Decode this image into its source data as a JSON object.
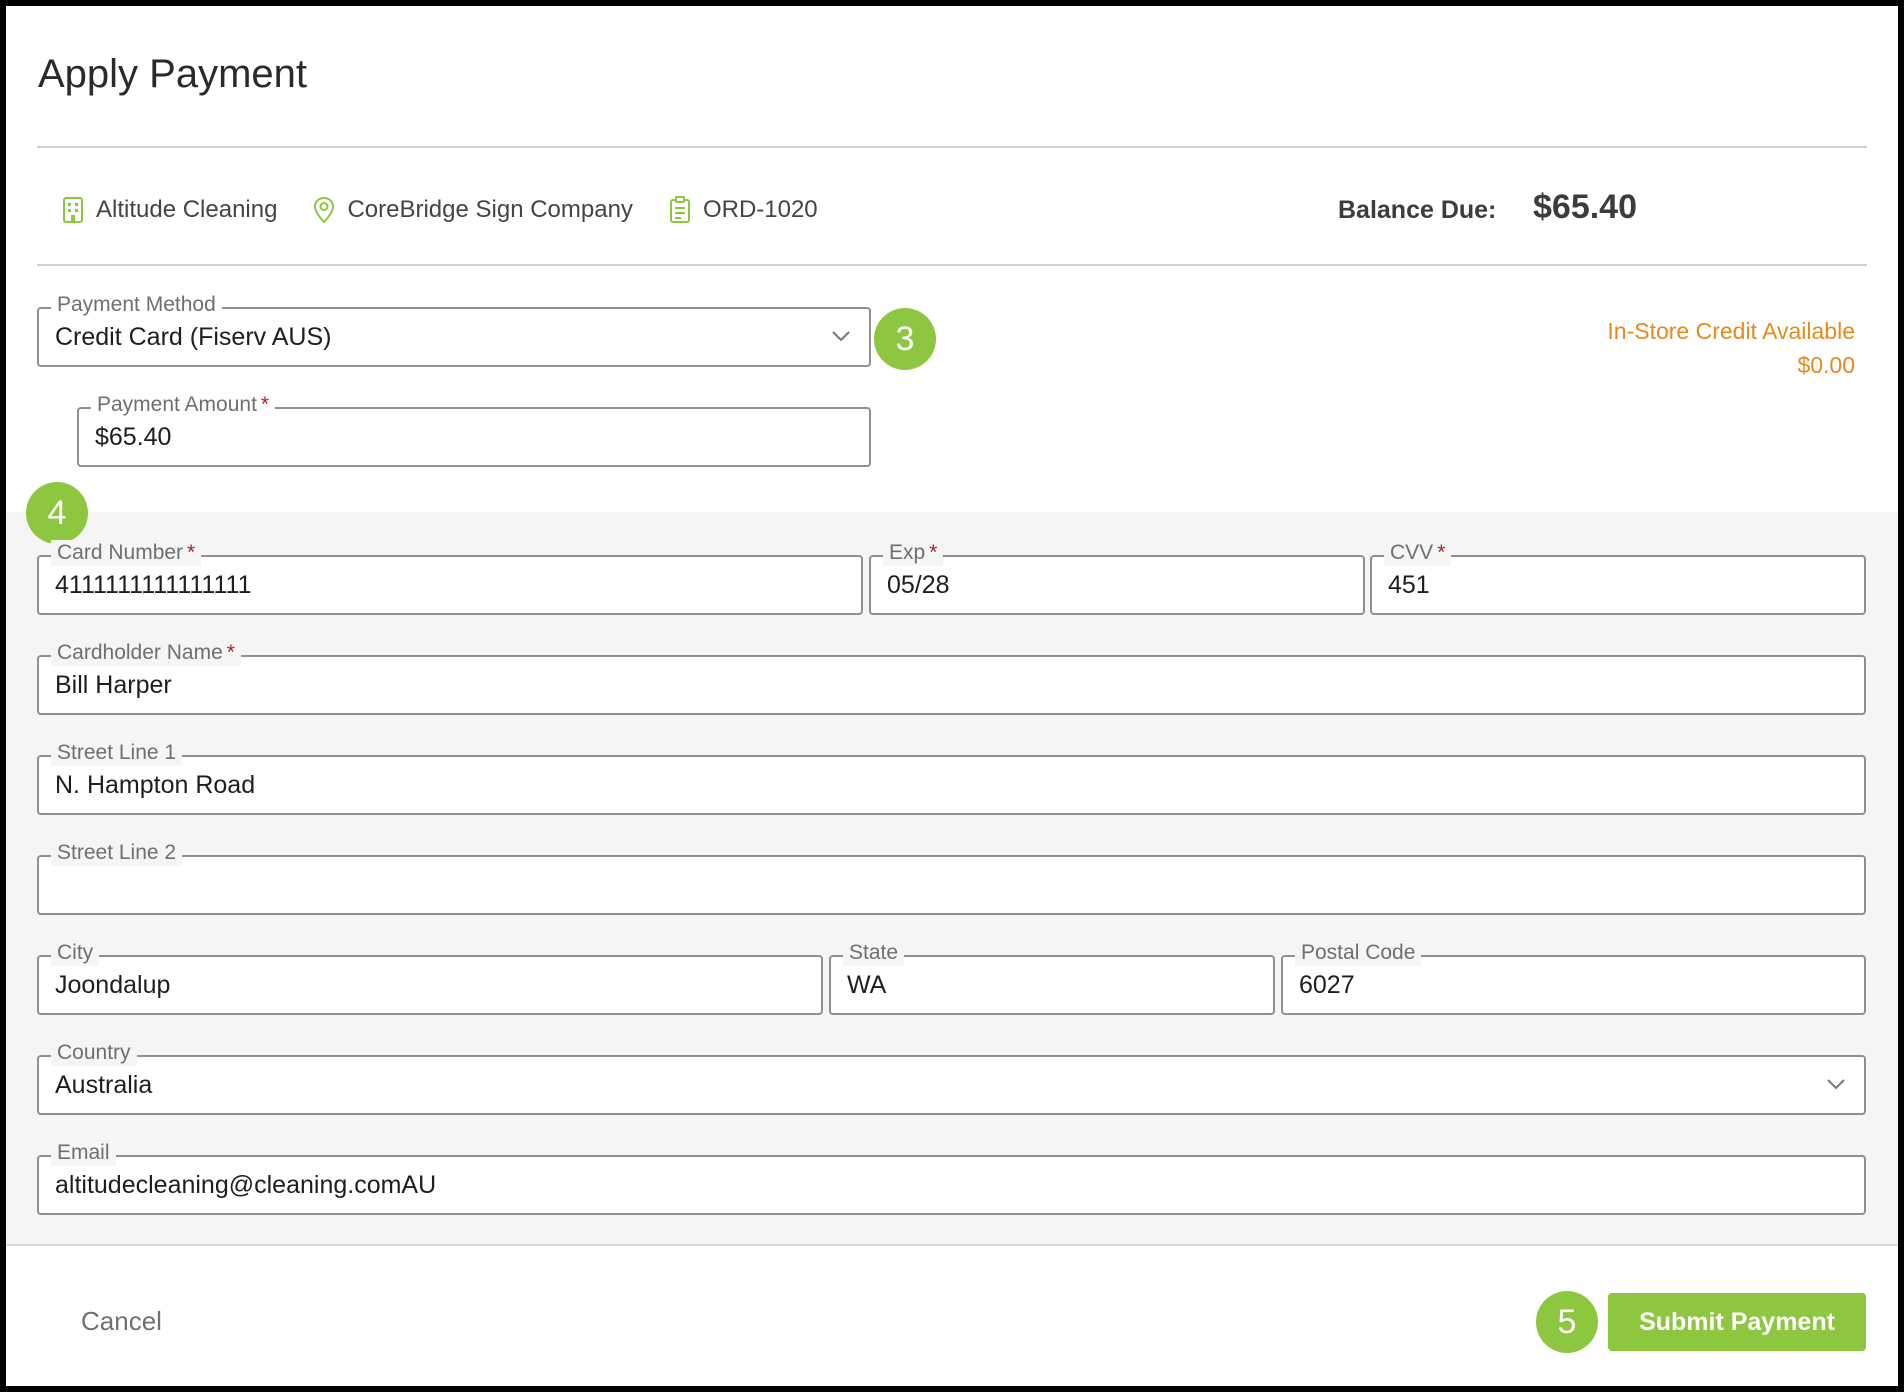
{
  "dialog": {
    "title": "Apply Payment"
  },
  "info": {
    "customer": "Altitude Cleaning",
    "location": "CoreBridge Sign Company",
    "order": "ORD-1020",
    "balance_label": "Balance Due:",
    "balance_value": "$65.40"
  },
  "payment": {
    "method_label": "Payment Method",
    "method_value": "Credit Card (Fiserv AUS)",
    "amount_label": "Payment Amount",
    "amount_value": "$65.40",
    "required_mark": "*"
  },
  "credit": {
    "label": "In-Store Credit Available",
    "value": "$0.00"
  },
  "card": {
    "number_label": "Card Number",
    "number_value": "4111111111111111",
    "exp_label": "Exp",
    "exp_value": "05/28",
    "cvv_label": "CVV",
    "cvv_value": "451",
    "name_label": "Cardholder Name",
    "name_value": "Bill Harper"
  },
  "address": {
    "street1_label": "Street Line 1",
    "street1_value": "N. Hampton Road",
    "street2_label": "Street Line 2",
    "street2_value": "",
    "city_label": "City",
    "city_value": "Joondalup",
    "state_label": "State",
    "state_value": "WA",
    "postal_label": "Postal Code",
    "postal_value": "6027",
    "country_label": "Country",
    "country_value": "Australia",
    "email_label": "Email",
    "email_value": "altitudecleaning@cleaning.comAU"
  },
  "badges": {
    "step3": "3",
    "step4": "4",
    "step5": "5"
  },
  "footer": {
    "cancel_label": "Cancel",
    "submit_label": "Submit Payment"
  },
  "colors": {
    "accent": "#8dc63f",
    "credit": "#e58a1f",
    "required": "#b0202a"
  },
  "icons": {
    "customer": "building-icon",
    "location": "map-pin-icon",
    "order": "clipboard-icon",
    "dropdown": "chevron-down-icon"
  }
}
